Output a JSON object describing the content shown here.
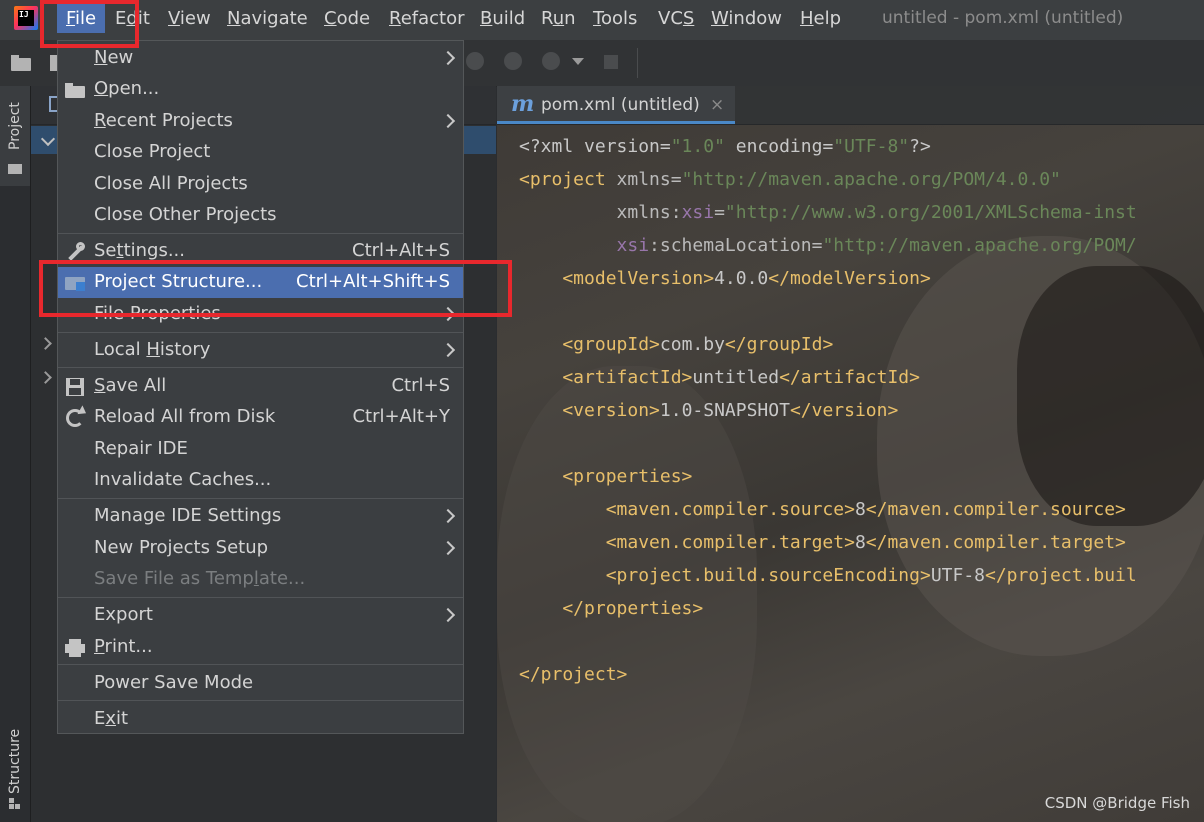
{
  "window": {
    "title": "untitled - pom.xml (untitled)"
  },
  "menubar": {
    "items": [
      {
        "pre": "",
        "u": "F",
        "post": "ile"
      },
      {
        "pre": "E",
        "u": "d",
        "post": "it"
      },
      {
        "pre": "",
        "u": "V",
        "post": "iew"
      },
      {
        "pre": "",
        "u": "N",
        "post": "avigate"
      },
      {
        "pre": "",
        "u": "C",
        "post": "ode"
      },
      {
        "pre": "",
        "u": "R",
        "post": "efactor"
      },
      {
        "pre": "",
        "u": "B",
        "post": "uild"
      },
      {
        "pre": "R",
        "u": "u",
        "post": "n"
      },
      {
        "pre": "",
        "u": "T",
        "post": "ools"
      },
      {
        "pre": "VC",
        "u": "S",
        "post": ""
      },
      {
        "pre": "",
        "u": "W",
        "post": "indow"
      },
      {
        "pre": "",
        "u": "H",
        "post": "elp"
      }
    ]
  },
  "logo_text": "IJ",
  "left_strip": {
    "project_tab": "Project",
    "structure_tab": "Structure"
  },
  "file_menu": {
    "items": [
      {
        "pre": "",
        "u": "N",
        "post": "ew",
        "shortcut": ""
      },
      {
        "pre": "",
        "u": "O",
        "post": "pen...",
        "shortcut": ""
      },
      {
        "pre": "",
        "u": "R",
        "post": "ecent Projects",
        "shortcut": ""
      },
      {
        "pre": "Close Project",
        "u": "",
        "post": "",
        "shortcut": ""
      },
      {
        "pre": "Close All Projects",
        "u": "",
        "post": "",
        "shortcut": ""
      },
      {
        "pre": "Close Other Projects",
        "u": "",
        "post": "",
        "shortcut": ""
      },
      {
        "pre": "Se",
        "u": "t",
        "post": "tings...",
        "shortcut": "Ctrl+Alt+S"
      },
      {
        "pre": "Project Structure...",
        "u": "",
        "post": "",
        "shortcut": "Ctrl+Alt+Shift+S"
      },
      {
        "pre": "File Properties",
        "u": "",
        "post": "",
        "shortcut": ""
      },
      {
        "pre": "Local ",
        "u": "H",
        "post": "istory",
        "shortcut": ""
      },
      {
        "pre": "",
        "u": "S",
        "post": "ave All",
        "shortcut": "Ctrl+S"
      },
      {
        "pre": "Reload All from Disk",
        "u": "",
        "post": "",
        "shortcut": "Ctrl+Alt+Y"
      },
      {
        "pre": "Repair IDE",
        "u": "",
        "post": "",
        "shortcut": ""
      },
      {
        "pre": "Invalidate Caches...",
        "u": "",
        "post": "",
        "shortcut": ""
      },
      {
        "pre": "Manage IDE Settings",
        "u": "",
        "post": "",
        "shortcut": ""
      },
      {
        "pre": "New Projects Setup",
        "u": "",
        "post": "",
        "shortcut": ""
      },
      {
        "pre": "Save File as Temp",
        "u": "l",
        "post": "ate...",
        "shortcut": ""
      },
      {
        "pre": "Export",
        "u": "",
        "post": "",
        "shortcut": ""
      },
      {
        "pre": "",
        "u": "P",
        "post": "rint...",
        "shortcut": ""
      },
      {
        "pre": "Power Save Mode",
        "u": "",
        "post": "",
        "shortcut": ""
      },
      {
        "pre": "E",
        "u": "x",
        "post": "it",
        "shortcut": ""
      }
    ]
  },
  "editor": {
    "tab_icon": "m",
    "tab_label": "pom.xml (untitled)",
    "tab_close": "×",
    "lines": [
      [
        [
          "c-text",
          "<?xml version="
        ],
        [
          "c-str",
          "\"1.0\""
        ],
        [
          "c-text",
          " encoding="
        ],
        [
          "c-str",
          "\"UTF-8\""
        ],
        [
          "c-text",
          "?>"
        ]
      ],
      [
        [
          "c-tag",
          "<project "
        ],
        [
          "c-attr",
          "xmlns="
        ],
        [
          "c-str",
          "\"http://maven.apache.org/POM/4.0.0\""
        ]
      ],
      [
        [
          "c-attr",
          "         xmlns:"
        ],
        [
          "c-ns",
          "xsi"
        ],
        [
          "c-attr",
          "="
        ],
        [
          "c-str",
          "\"http://www.w3.org/2001/XMLSchema-inst"
        ]
      ],
      [
        [
          "c-ns",
          "         xsi"
        ],
        [
          "c-attr",
          ":schemaLocation="
        ],
        [
          "c-str",
          "\"http://maven.apache.org/POM/"
        ]
      ],
      [
        [
          "c-tag",
          "    <modelVersion>"
        ],
        [
          "c-text",
          "4.0.0"
        ],
        [
          "c-tag",
          "</modelVersion>"
        ]
      ],
      [
        [
          "c-text",
          ""
        ]
      ],
      [
        [
          "c-tag",
          "    <groupId>"
        ],
        [
          "c-text",
          "com.by"
        ],
        [
          "c-tag",
          "</groupId>"
        ]
      ],
      [
        [
          "c-tag",
          "    <artifactId>"
        ],
        [
          "c-text",
          "untitled"
        ],
        [
          "c-tag",
          "</artifactId>"
        ]
      ],
      [
        [
          "c-tag",
          "    <version>"
        ],
        [
          "c-text",
          "1.0-SNAPSHOT"
        ],
        [
          "c-tag",
          "</version>"
        ]
      ],
      [
        [
          "c-text",
          ""
        ]
      ],
      [
        [
          "c-tag",
          "    <properties>"
        ]
      ],
      [
        [
          "c-tag",
          "        <maven.compiler.source>"
        ],
        [
          "c-text",
          "8"
        ],
        [
          "c-tag",
          "</maven.compiler.source>"
        ]
      ],
      [
        [
          "c-tag",
          "        <maven.compiler.target>"
        ],
        [
          "c-text",
          "8"
        ],
        [
          "c-tag",
          "</maven.compiler.target>"
        ]
      ],
      [
        [
          "c-tag",
          "        <project.build.sourceEncoding>"
        ],
        [
          "c-text",
          "UTF-8"
        ],
        [
          "c-tag",
          "</project.buil"
        ]
      ],
      [
        [
          "c-tag",
          "    </properties>"
        ]
      ],
      [
        [
          "c-text",
          ""
        ]
      ],
      [
        [
          "c-tag",
          "</project>"
        ]
      ]
    ]
  },
  "watermark": "CSDN @Bridge Fish",
  "colors": {
    "accent_selected": "#4b6eaf",
    "highlight_annotation": "#e8282d"
  }
}
